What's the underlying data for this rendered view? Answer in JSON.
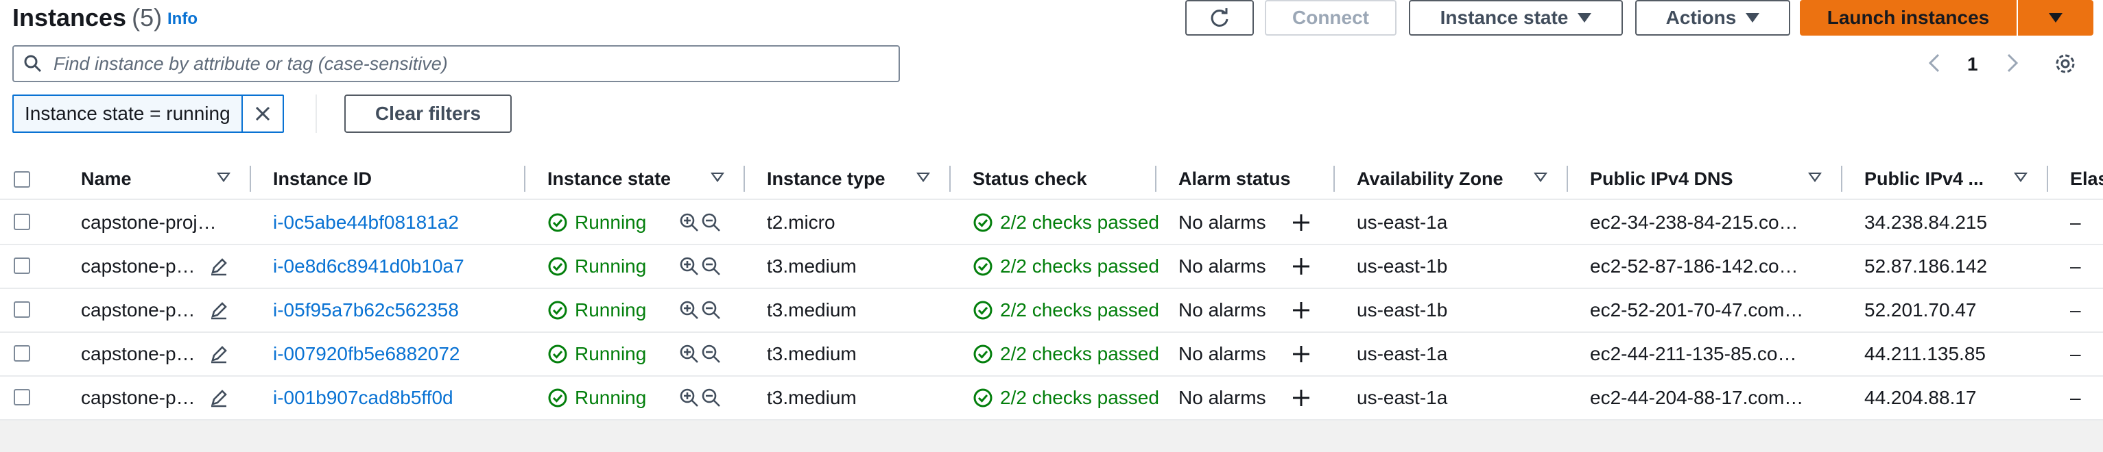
{
  "header": {
    "title": "Instances",
    "count": "(5)",
    "info_label": "Info"
  },
  "toolbar": {
    "connect_label": "Connect",
    "instance_state_label": "Instance state",
    "actions_label": "Actions",
    "launch_label": "Launch instances"
  },
  "search": {
    "placeholder": "Find instance by attribute or tag (case-sensitive)"
  },
  "pagination": {
    "current_page": "1"
  },
  "filters": {
    "active_token": "Instance state = running",
    "clear_label": "Clear filters"
  },
  "table": {
    "columns": [
      "Name",
      "Instance ID",
      "Instance state",
      "Instance type",
      "Status check",
      "Alarm status",
      "Availability Zone",
      "Public IPv4 DNS",
      "Public IPv4 ...",
      "Elas"
    ],
    "rows": [
      {
        "name": "capstone-proj…",
        "id": "i-0c5abe44bf08181a2",
        "state": "Running",
        "type": "t2.micro",
        "status": "2/2 checks passed",
        "alarm": "No alarms",
        "az": "us-east-1a",
        "dns": "ec2-34-238-84-215.co…",
        "ip": "34.238.84.215",
        "elastic": "–"
      },
      {
        "name": "capstone-p…",
        "id": "i-0e8d6c8941d0b10a7",
        "state": "Running",
        "type": "t3.medium",
        "status": "2/2 checks passed",
        "alarm": "No alarms",
        "az": "us-east-1b",
        "dns": "ec2-52-87-186-142.co…",
        "ip": "52.87.186.142",
        "elastic": "–"
      },
      {
        "name": "capstone-p…",
        "id": "i-05f95a7b62c562358",
        "state": "Running",
        "type": "t3.medium",
        "status": "2/2 checks passed",
        "alarm": "No alarms",
        "az": "us-east-1b",
        "dns": "ec2-52-201-70-47.com…",
        "ip": "52.201.70.47",
        "elastic": "–"
      },
      {
        "name": "capstone-p…",
        "id": "i-007920fb5e6882072",
        "state": "Running",
        "type": "t3.medium",
        "status": "2/2 checks passed",
        "alarm": "No alarms",
        "az": "us-east-1a",
        "dns": "ec2-44-211-135-85.co…",
        "ip": "44.211.135.85",
        "elastic": "–"
      },
      {
        "name": "capstone-p…",
        "id": "i-001b907cad8b5ff0d",
        "state": "Running",
        "type": "t3.medium",
        "status": "2/2 checks passed",
        "alarm": "No alarms",
        "az": "us-east-1a",
        "dns": "ec2-44-204-88-17.com…",
        "ip": "44.204.88.17",
        "elastic": "–"
      }
    ]
  },
  "colors": {
    "primary": "#ec7211",
    "link": "#0972d3",
    "success": "#037f0c"
  },
  "icons": {
    "refresh": "refresh-icon",
    "search": "search-icon",
    "settings": "gear-icon",
    "running": "check-circle-icon",
    "zoom_in": "zoom-in-icon",
    "zoom_out": "zoom-out-icon",
    "edit": "pencil-icon",
    "add_alarm": "plus-icon"
  }
}
